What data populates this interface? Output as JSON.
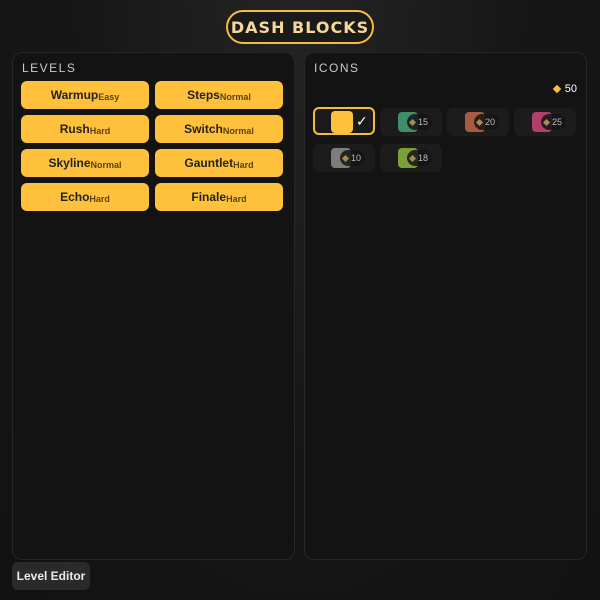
{
  "title": "DASH BLOCKS",
  "levels": {
    "label": "LEVELS",
    "items": [
      {
        "name": "Warmup",
        "difficulty": "Easy"
      },
      {
        "name": "Steps",
        "difficulty": "Normal"
      },
      {
        "name": "Rush",
        "difficulty": "Hard"
      },
      {
        "name": "Switch",
        "difficulty": "Normal"
      },
      {
        "name": "Skyline",
        "difficulty": "Normal"
      },
      {
        "name": "Gauntlet",
        "difficulty": "Hard"
      },
      {
        "name": "Echo",
        "difficulty": "Hard"
      },
      {
        "name": "Finale",
        "difficulty": "Hard"
      }
    ]
  },
  "icons": {
    "label": "ICONS",
    "coins": "50",
    "check": "✓",
    "items": [
      {
        "color": "#ffc13b",
        "selected": true
      },
      {
        "color": "#3f8e6a",
        "price": "15"
      },
      {
        "color": "#a85a44",
        "price": "20"
      },
      {
        "color": "#b0406a",
        "price": "25"
      },
      {
        "color": "#7d7d7d",
        "price": "10"
      },
      {
        "color": "#7aa03a",
        "price": "18"
      }
    ]
  },
  "editor": {
    "label": "Level Editor"
  }
}
